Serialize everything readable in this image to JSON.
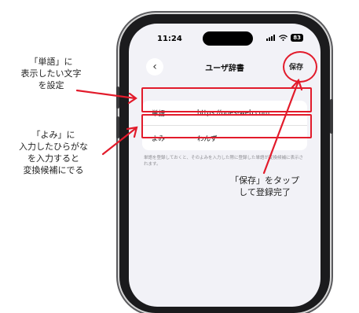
{
  "status": {
    "time": "11:24",
    "battery": "83"
  },
  "nav": {
    "back_icon": "chevron-left-icon",
    "title": "ユーザ辞書",
    "save_label": "保存"
  },
  "form": {
    "rows": [
      {
        "label": "単語",
        "value": "https://ones-web.com"
      },
      {
        "label": "よみ",
        "value": "わんず"
      }
    ],
    "note": "単語を登録しておくと、そのよみを入力した際に登録した単語が変換候補に表示されます。"
  },
  "annotations": {
    "word": [
      "「単語」に",
      "表示したい文字",
      "を設定"
    ],
    "reading": [
      "「よみ」に",
      "入力したひらがな",
      "を入力すると",
      "変換候補にでる"
    ],
    "save": [
      "「保存」をタップ",
      "して登録完了"
    ]
  },
  "colors": {
    "annotation_red": "#e21b2b"
  }
}
